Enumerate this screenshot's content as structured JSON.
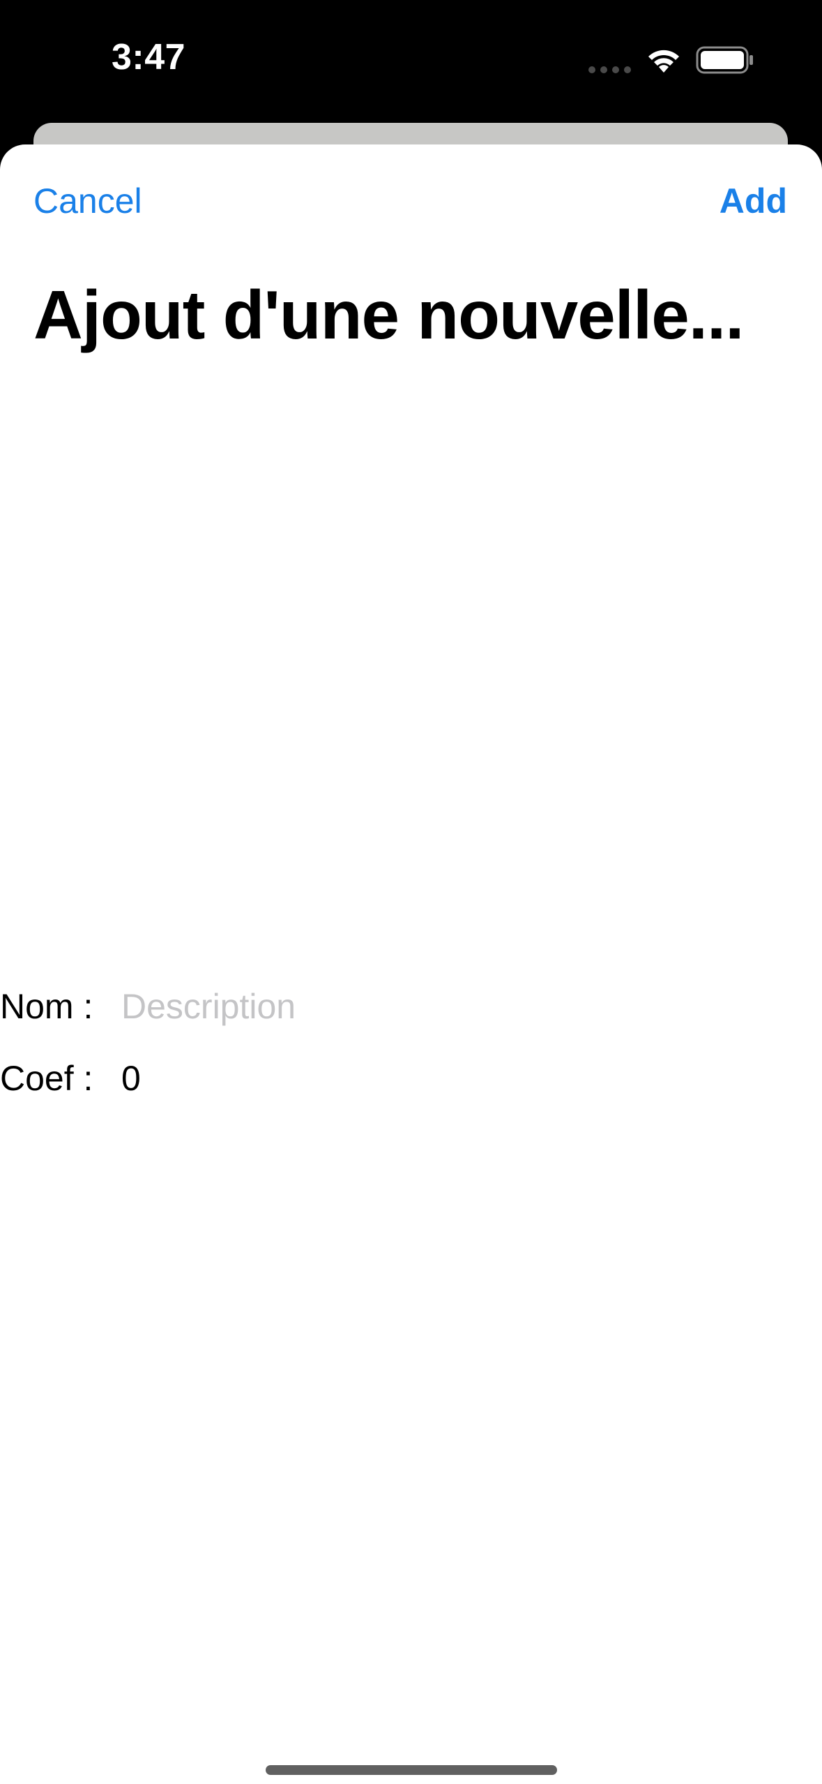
{
  "status_bar": {
    "time": "3:47"
  },
  "toolbar": {
    "cancel_label": "Cancel",
    "add_label": "Add"
  },
  "page": {
    "title": "Ajout d'une nouvelle..."
  },
  "form": {
    "name_label": "Nom :",
    "name_value": "",
    "name_placeholder": "Description",
    "coef_label": "Coef :",
    "coef_value": "0"
  },
  "colors": {
    "accent": "#1a80e8",
    "placeholder": "#c4c4c6",
    "sheet_background": "#ffffff",
    "status_bar_background": "#000000"
  },
  "icons": {
    "signal": "cellular-signal-icon",
    "wifi": "wifi-icon",
    "battery": "battery-icon"
  }
}
